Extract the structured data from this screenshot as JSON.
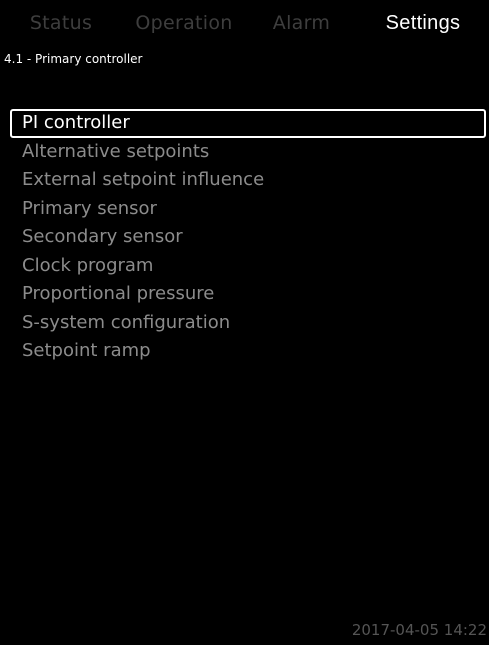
{
  "tabs": [
    {
      "label": "Status"
    },
    {
      "label": "Operation"
    },
    {
      "label": "Alarm"
    },
    {
      "label": "Settings"
    }
  ],
  "active_tab": "Settings",
  "page_title": "4.1 - Primary controller",
  "menu_items": [
    {
      "label": "PI controller"
    },
    {
      "label": "Alternative setpoints"
    },
    {
      "label": "External setpoint influence"
    },
    {
      "label": "Primary sensor"
    },
    {
      "label": "Secondary sensor"
    },
    {
      "label": "Clock program"
    },
    {
      "label": "Proportional pressure"
    },
    {
      "label": "S-system configuration"
    },
    {
      "label": "Setpoint ramp"
    }
  ],
  "selected_item": "PI controller",
  "timestamp": "2017-04-05 14:22",
  "colors": {
    "background": "#000000",
    "active_text": "#ffffff",
    "inactive_tab": "#3e3e3e",
    "menu_item": "#8c8c8c",
    "timestamp": "#555555"
  }
}
